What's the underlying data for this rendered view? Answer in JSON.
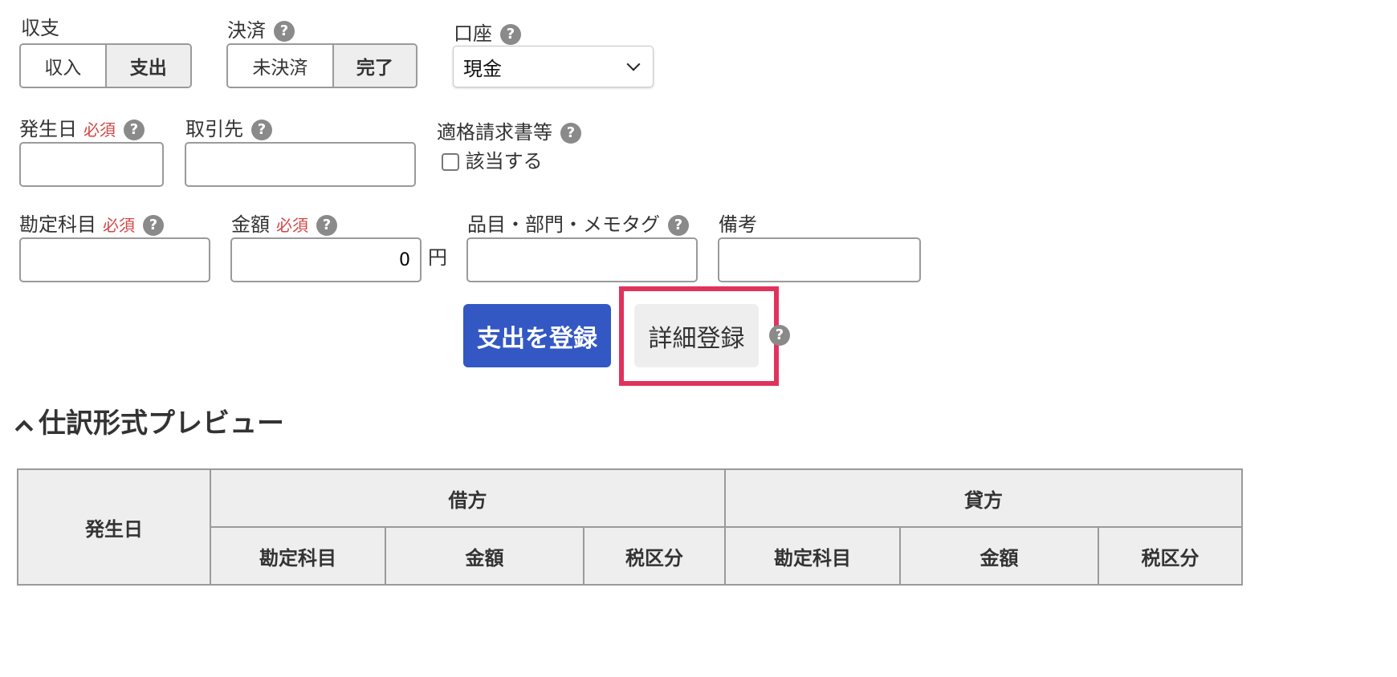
{
  "form": {
    "income_expense": {
      "label": "収支",
      "options": [
        "収入",
        "支出"
      ],
      "selected": "支出"
    },
    "settlement": {
      "label": "決済",
      "options": [
        "未決済",
        "完了"
      ],
      "selected": "完了"
    },
    "account": {
      "label": "口座",
      "value": "現金"
    },
    "date": {
      "label": "発生日",
      "required": "必須",
      "value": ""
    },
    "partner": {
      "label": "取引先",
      "value": ""
    },
    "invoice": {
      "label": "適格請求書等",
      "checkbox_label": "該当する",
      "checked": false
    },
    "account_item": {
      "label": "勘定科目",
      "required": "必須",
      "value": ""
    },
    "amount": {
      "label": "金額",
      "required": "必須",
      "value": "0",
      "unit": "円"
    },
    "tags": {
      "label": "品目・部門・メモタグ",
      "value": ""
    },
    "note": {
      "label": "備考",
      "value": ""
    },
    "help_glyph": "?"
  },
  "actions": {
    "register": "支出を登録",
    "detail_register": "詳細登録"
  },
  "preview": {
    "title": "仕訳形式プレビュー",
    "headers": {
      "date": "発生日",
      "debit": "借方",
      "credit": "貸方",
      "account_item": "勘定科目",
      "amount": "金額",
      "tax": "税区分"
    }
  },
  "colors": {
    "primary": "#3358c4",
    "income_blue": "#2f5ec4",
    "expense_red": "#d24545",
    "highlight": "#e0325d"
  }
}
